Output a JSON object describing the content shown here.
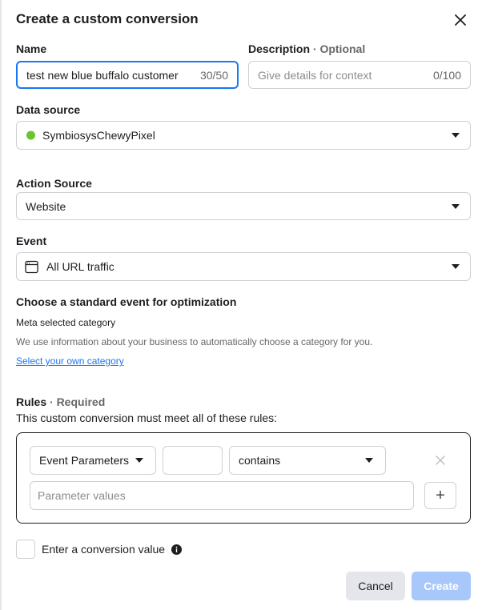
{
  "dialog": {
    "title": "Create a custom conversion"
  },
  "name": {
    "label": "Name",
    "value": "test new blue buffalo customer",
    "counter": "30/50"
  },
  "description": {
    "label": "Description",
    "optional": "· Optional",
    "placeholder": "Give details for context",
    "counter": "0/100"
  },
  "data_source": {
    "label": "Data source",
    "value": "SymbiosysChewyPixel",
    "status_color": "#6bc32f"
  },
  "action_source": {
    "label": "Action Source",
    "value": "Website"
  },
  "event": {
    "label": "Event",
    "icon": "browser-window-icon",
    "value": "All URL traffic"
  },
  "optimization": {
    "heading": "Choose a standard event for optimization",
    "category_label": "Meta selected category",
    "description": "We use information about your business to automatically choose a category for you.",
    "link": "Select your own category"
  },
  "rules": {
    "label": "Rules",
    "required": "· Required",
    "description": "This custom conversion must meet all of these rules:",
    "parameter_type": "Event Parameters",
    "key_value": "",
    "operator": "contains",
    "values_placeholder": "Parameter values"
  },
  "conversion_value": {
    "label": "Enter a conversion value"
  },
  "footer": {
    "cancel": "Cancel",
    "create": "Create"
  },
  "colors": {
    "accent": "#1877f2",
    "disabled_primary": "#a8c7fa"
  }
}
